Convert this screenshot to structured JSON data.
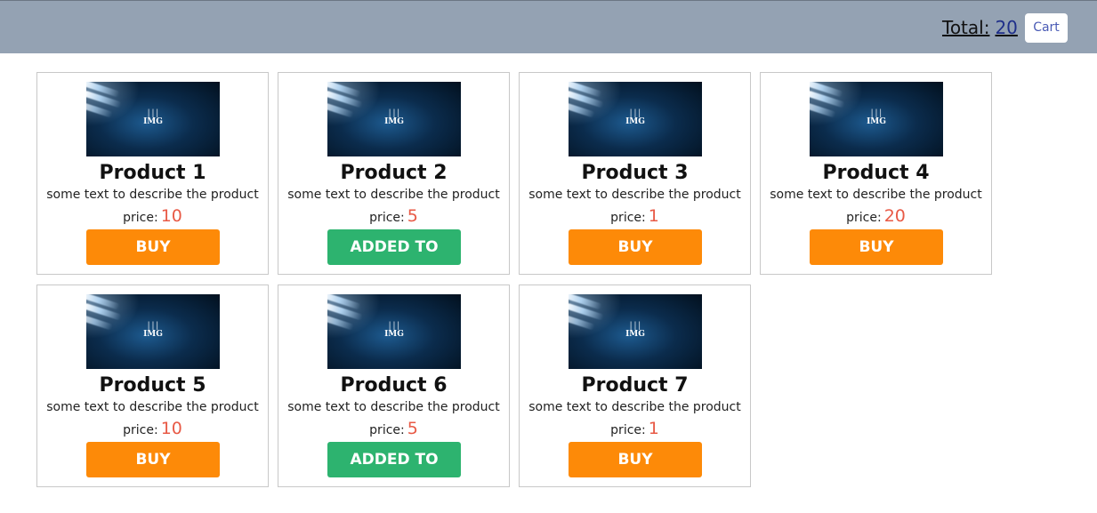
{
  "header": {
    "total_label": "Total:",
    "total_value": "20",
    "cart_label": "Cart"
  },
  "image_logo_text": "IMG",
  "products": [
    {
      "title": "Product 1",
      "description": "some text to describe the product",
      "price_label": "price:",
      "price": "10",
      "button_label": "BUY",
      "added": false
    },
    {
      "title": "Product 2",
      "description": "some text to describe the product",
      "price_label": "price:",
      "price": "5",
      "button_label": "ADDED TO CART",
      "added": true
    },
    {
      "title": "Product 3",
      "description": "some text to describe the product",
      "price_label": "price:",
      "price": "1",
      "button_label": "BUY",
      "added": false
    },
    {
      "title": "Product 4",
      "description": "some text to describe the product",
      "price_label": "price:",
      "price": "20",
      "button_label": "BUY",
      "added": false
    },
    {
      "title": "Product 5",
      "description": "some text to describe the product",
      "price_label": "price:",
      "price": "10",
      "button_label": "BUY",
      "added": false
    },
    {
      "title": "Product 6",
      "description": "some text to describe the product",
      "price_label": "price:",
      "price": "5",
      "button_label": "ADDED TO CART",
      "added": true
    },
    {
      "title": "Product 7",
      "description": "some text to describe the product",
      "price_label": "price:",
      "price": "1",
      "button_label": "BUY",
      "added": false
    }
  ],
  "colors": {
    "header_bg": "#94a2b3",
    "buy_button": "#fd8a08",
    "added_button": "#2db36f",
    "price": "#e85a46",
    "total_value": "#1f2f8a"
  }
}
